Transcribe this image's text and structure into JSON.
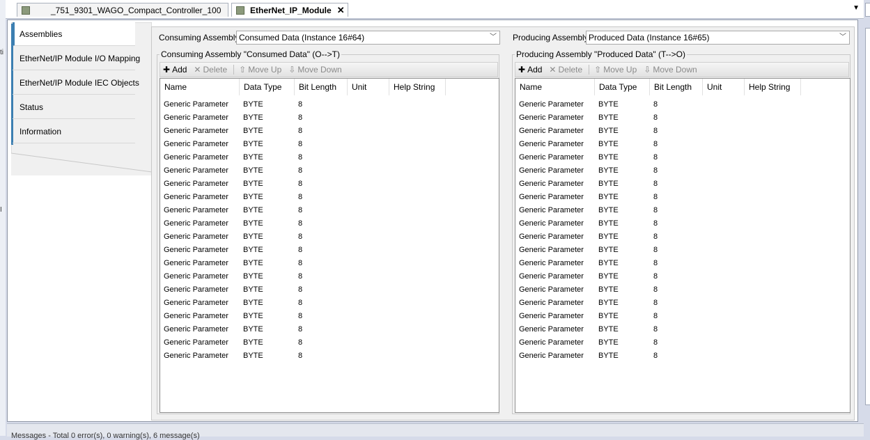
{
  "tabs": [
    {
      "label": "_751_9301_WAGO_Compact_Controller_100",
      "active": false
    },
    {
      "label": "EtherNet_IP_Module",
      "active": true
    }
  ],
  "sidebar": {
    "items": [
      {
        "label": "Assemblies",
        "selected": true
      },
      {
        "label": "EtherNet/IP Module I/O Mapping",
        "selected": false
      },
      {
        "label": "EtherNet/IP Module IEC Objects",
        "selected": false
      },
      {
        "label": "Status",
        "selected": false
      },
      {
        "label": "Information",
        "selected": false
      }
    ]
  },
  "consuming": {
    "assembly_label": "Consuming Assembly",
    "assembly_value": "Consumed Data (Instance 16#64)",
    "group_title": "Consuming Assembly \"Consumed Data\" (O-->T)"
  },
  "producing": {
    "assembly_label": "Producing Assembly",
    "assembly_value": "Produced Data (Instance 16#65)",
    "group_title": "Producing Assembly \"Produced Data\" (T-->O)"
  },
  "toolbar": {
    "add": "Add",
    "delete": "Delete",
    "move_up": "Move Up",
    "move_down": "Move Down"
  },
  "table": {
    "columns": [
      "Name",
      "Data Type",
      "Bit Length",
      "Unit",
      "Help String"
    ],
    "row": {
      "name": "Generic Parameter",
      "data_type": "BYTE",
      "bit_length": "8",
      "unit": "",
      "help": ""
    },
    "row_count": 20
  },
  "statusbar": {
    "text": "Messages - Total 0 error(s), 0 warning(s), 6 message(s)"
  },
  "icons": {
    "add": "plus-icon",
    "delete": "x-icon",
    "move_up": "arrow-up-icon",
    "move_down": "arrow-down-icon"
  }
}
